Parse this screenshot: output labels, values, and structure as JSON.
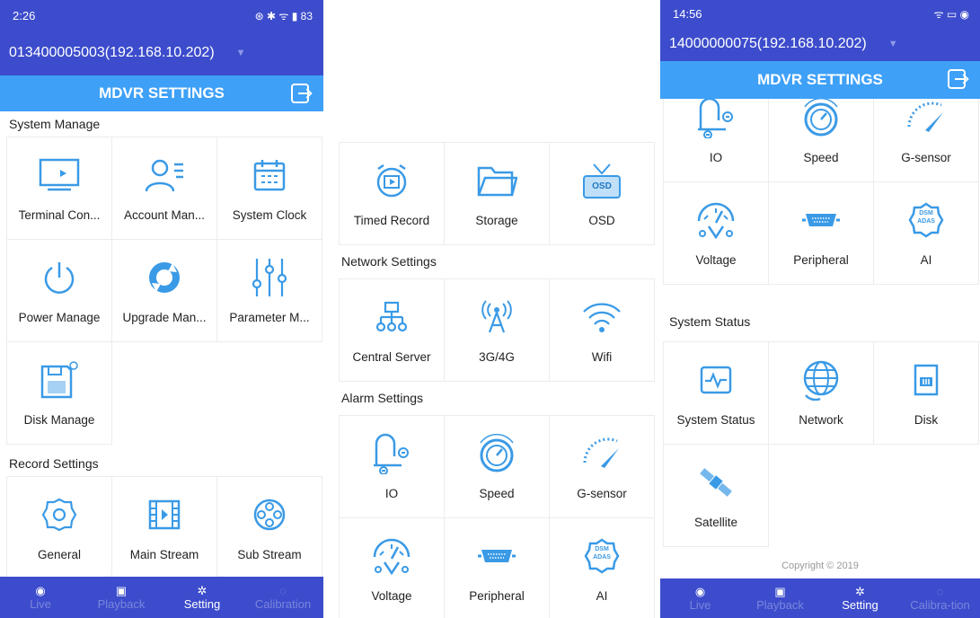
{
  "colors": {
    "header": "#3c4ccc",
    "title_bar": "#3ea0f7",
    "icon": "#3a9ae6"
  },
  "screen1": {
    "status": {
      "time": "2:26",
      "icons": "⊛ ✱ ᯤ ▮ 83"
    },
    "device": "013400005003(192.168.10.202)",
    "title": "MDVR SETTINGS",
    "sections": [
      {
        "title": "System Manage",
        "items": [
          {
            "label": "Terminal Con...",
            "icon": "monitor-icon"
          },
          {
            "label": "Account Man...",
            "icon": "account-icon"
          },
          {
            "label": "System Clock",
            "icon": "calendar-icon"
          },
          {
            "label": "Power Manage",
            "icon": "power-icon"
          },
          {
            "label": "Upgrade Man...",
            "icon": "refresh-icon"
          },
          {
            "label": "Parameter M...",
            "icon": "sliders-icon"
          },
          {
            "label": "Disk Manage",
            "icon": "disk-icon"
          }
        ]
      },
      {
        "title": "Record Settings",
        "items": [
          {
            "label": "General",
            "icon": "gear-icon"
          },
          {
            "label": "Main Stream",
            "icon": "film-icon"
          },
          {
            "label": "Sub Stream",
            "icon": "reel-icon"
          }
        ]
      }
    ],
    "nav": [
      {
        "label": "Live",
        "icon": "live-icon"
      },
      {
        "label": "Playback",
        "icon": "playback-icon"
      },
      {
        "label": "Setting",
        "icon": "gear-icon"
      },
      {
        "label": "Calibration",
        "icon": "calibration-icon"
      }
    ]
  },
  "screen2": {
    "top_items": [
      {
        "label": "Timed Record",
        "icon": "alarm-clock-icon"
      },
      {
        "label": "Storage",
        "icon": "folder-icon"
      },
      {
        "label": "OSD",
        "icon": "tv-icon",
        "badge": "OSD"
      }
    ],
    "sections": [
      {
        "title": "Network Settings",
        "items": [
          {
            "label": "Central Server",
            "icon": "server-icon"
          },
          {
            "label": "3G/4G",
            "icon": "antenna-icon"
          },
          {
            "label": "Wifi",
            "icon": "wifi-icon"
          }
        ]
      },
      {
        "title": "Alarm Settings",
        "items": [
          {
            "label": "IO",
            "icon": "io-icon"
          },
          {
            "label": "Speed",
            "icon": "speed-icon"
          },
          {
            "label": "G-sensor",
            "icon": "gsensor-icon"
          },
          {
            "label": "Voltage",
            "icon": "voltage-icon"
          },
          {
            "label": "Peripheral",
            "icon": "peripheral-icon"
          },
          {
            "label": "AI",
            "icon": "ai-icon",
            "badge": "DSM ADAS"
          }
        ]
      }
    ]
  },
  "screen3": {
    "status": {
      "time": "14:56",
      "icons": "ᯤ ▭ ◉"
    },
    "device": "14000000075(192.168.10.202)",
    "title": "MDVR SETTINGS",
    "top_items": [
      {
        "label": "IO",
        "icon": "io-icon"
      },
      {
        "label": "Speed",
        "icon": "speed-icon"
      },
      {
        "label": "G-sensor",
        "icon": "gsensor-icon"
      },
      {
        "label": "Voltage",
        "icon": "voltage-icon"
      },
      {
        "label": "Peripheral",
        "icon": "peripheral-icon"
      },
      {
        "label": "AI",
        "icon": "ai-icon",
        "badge": "DSM ADAS"
      }
    ],
    "sections": [
      {
        "title": "System Status",
        "items": [
          {
            "label": "System Status",
            "icon": "pulse-icon"
          },
          {
            "label": "Network",
            "icon": "globe-icon"
          },
          {
            "label": "Disk",
            "icon": "sdcard-icon"
          },
          {
            "label": "Satellite",
            "icon": "satellite-icon"
          }
        ]
      }
    ],
    "copyright": "Copyright © 2019",
    "nav": [
      {
        "label": "Live",
        "icon": "live-icon"
      },
      {
        "label": "Playback",
        "icon": "playback-icon"
      },
      {
        "label": "Setting",
        "icon": "gear-icon"
      },
      {
        "label": "Calibra-tion",
        "icon": "calibration-icon"
      }
    ]
  }
}
